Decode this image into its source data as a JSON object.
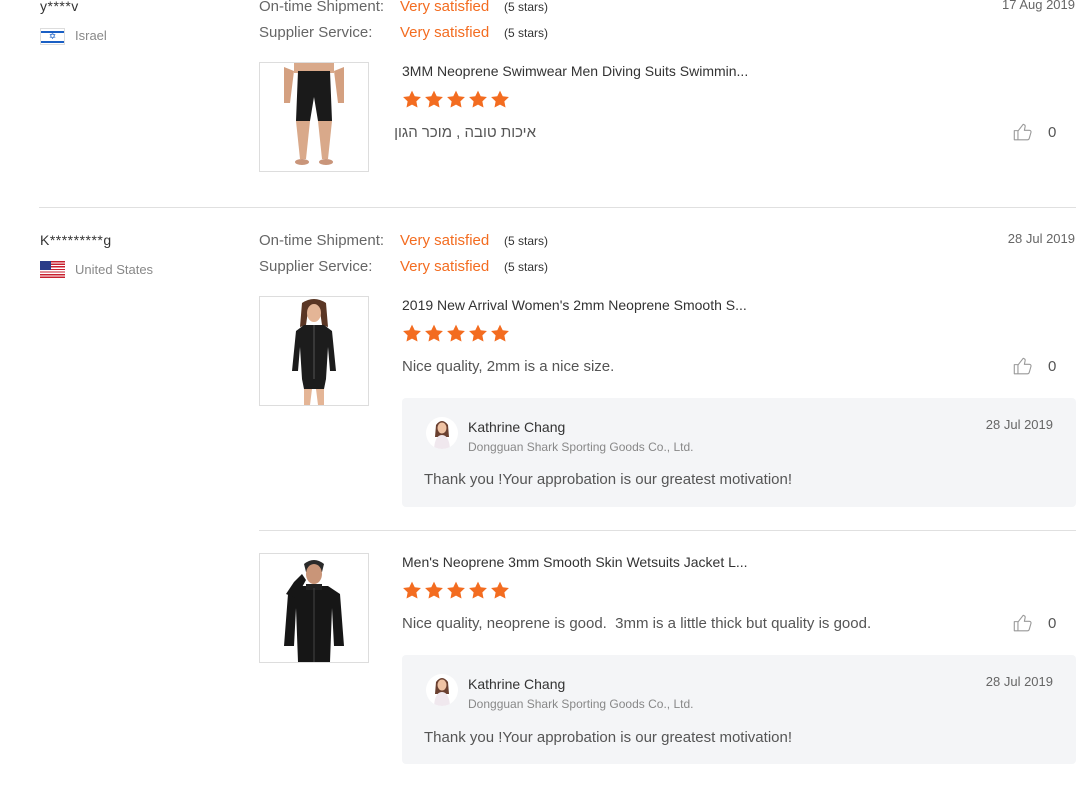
{
  "rating_labels": {
    "shipment": "On-time Shipment:",
    "service": "Supplier Service:"
  },
  "accent_color": "#f36c20",
  "reviews": [
    {
      "buyer": "y****v",
      "country": "Israel",
      "flag_icon": "israel-flag-icon",
      "date": "17 Aug 2019",
      "shipment_value": "Very satisfied",
      "shipment_stars": "(5 stars)",
      "service_value": "Very satisfied",
      "service_stars": "(5 stars)",
      "items": [
        {
          "title": "3MM Neoprene Swimwear Men Diving Suits Swimmin...",
          "rating": 5,
          "text": "איכות טובה , מוכר הגון",
          "likes": "0"
        }
      ]
    },
    {
      "buyer": "K*********g",
      "country": "United States",
      "flag_icon": "us-flag-icon",
      "date": "28 Jul 2019",
      "shipment_value": "Very satisfied",
      "shipment_stars": "(5 stars)",
      "service_value": "Very satisfied",
      "service_stars": "(5 stars)",
      "items": [
        {
          "title": "2019 New Arrival Women's 2mm Neoprene Smooth S...",
          "rating": 5,
          "text": "Nice quality, 2mm is a nice size.",
          "likes": "0",
          "reply": {
            "name": "Kathrine Chang",
            "company": "Dongguan Shark Sporting Goods Co., Ltd.",
            "date": "28 Jul 2019",
            "text": "Thank you !Your approbation is our greatest motivation!"
          }
        },
        {
          "title": "Men's Neoprene 3mm Smooth Skin Wetsuits Jacket L...",
          "rating": 5,
          "text": "Nice quality, neoprene is good.  3mm is a little thick but quality is good.",
          "likes": "0",
          "reply": {
            "name": "Kathrine Chang",
            "company": "Dongguan Shark Sporting Goods Co., Ltd.",
            "date": "28 Jul 2019",
            "text": "Thank you !Your approbation is our greatest motivation!"
          }
        }
      ]
    }
  ]
}
